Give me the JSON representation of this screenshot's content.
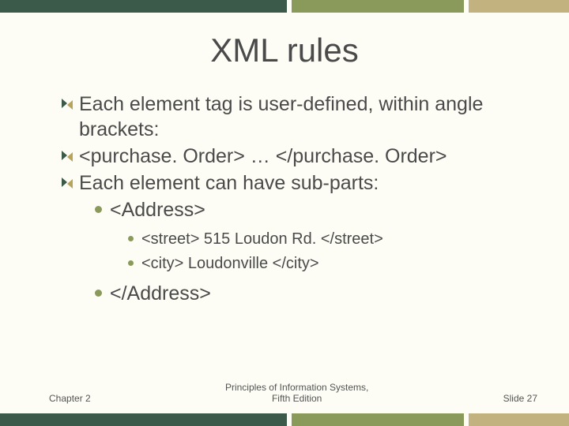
{
  "title": "XML rules",
  "bullets": {
    "b1": "Each element tag is user-defined, within angle brackets:",
    "b2": "<purchase. Order> … </purchase. Order>",
    "b3": "Each element can have sub-parts:",
    "s1": "<Address>",
    "ss1": "<street>  515 Loudon Rd. </street>",
    "ss2": "<city> Loudonville </city>",
    "s2": "</Address>"
  },
  "footer": {
    "left": "Chapter  2",
    "center_l1": "Principles of Information Systems,",
    "center_l2": "Fifth Edition",
    "right": "Slide 27"
  }
}
